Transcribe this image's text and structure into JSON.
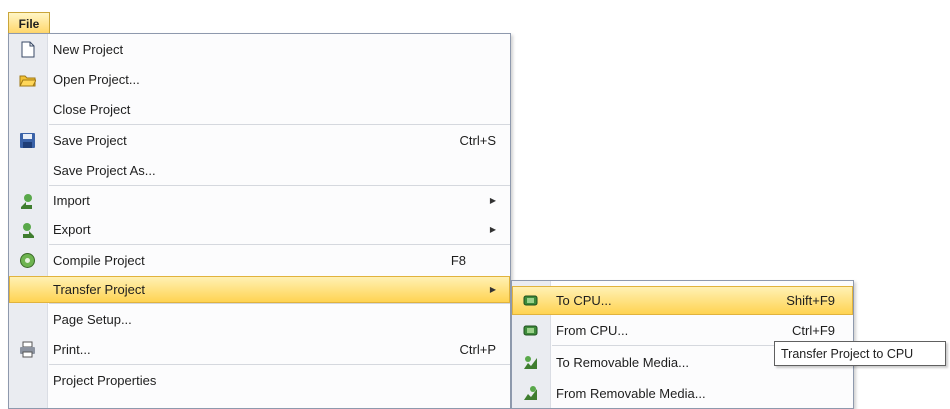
{
  "menubar": {
    "file_label": "File"
  },
  "file_menu": {
    "items": [
      {
        "label": "New Project",
        "icon": "new-document-icon"
      },
      {
        "label": "Open Project...",
        "icon": "open-folder-icon"
      },
      {
        "label": "Close Project"
      },
      {
        "label": "Save Project",
        "shortcut": "Ctrl+S",
        "icon": "save-disk-icon"
      },
      {
        "label": "Save Project As..."
      },
      {
        "label": "Import",
        "has_submenu": true,
        "icon": "import-icon"
      },
      {
        "label": "Export",
        "has_submenu": true,
        "icon": "export-icon"
      },
      {
        "label": "Compile Project",
        "shortcut": "F8",
        "icon": "compile-icon"
      },
      {
        "label": "Transfer Project",
        "has_submenu": true,
        "highlighted": true
      },
      {
        "label": "Page Setup..."
      },
      {
        "label": "Print...",
        "shortcut": "Ctrl+P",
        "icon": "printer-icon"
      },
      {
        "label": "Project Properties"
      }
    ]
  },
  "transfer_submenu": {
    "items": [
      {
        "label": "To CPU...",
        "shortcut": "Shift+F9",
        "icon": "to-cpu-icon",
        "highlighted": true
      },
      {
        "label": "From CPU...",
        "shortcut": "Ctrl+F9",
        "icon": "from-cpu-icon"
      },
      {
        "label": "To Removable Media...",
        "icon": "to-removable-media-icon"
      },
      {
        "label": "From Removable Media...",
        "icon": "from-removable-media-icon"
      }
    ]
  },
  "tooltip": {
    "text": "Transfer Project to CPU"
  },
  "colors": {
    "highlight_top": "#fff2b8",
    "highlight_bottom": "#ffd24e",
    "menu_border": "#8e99ad",
    "icon_gutter": "#eaecf1"
  }
}
